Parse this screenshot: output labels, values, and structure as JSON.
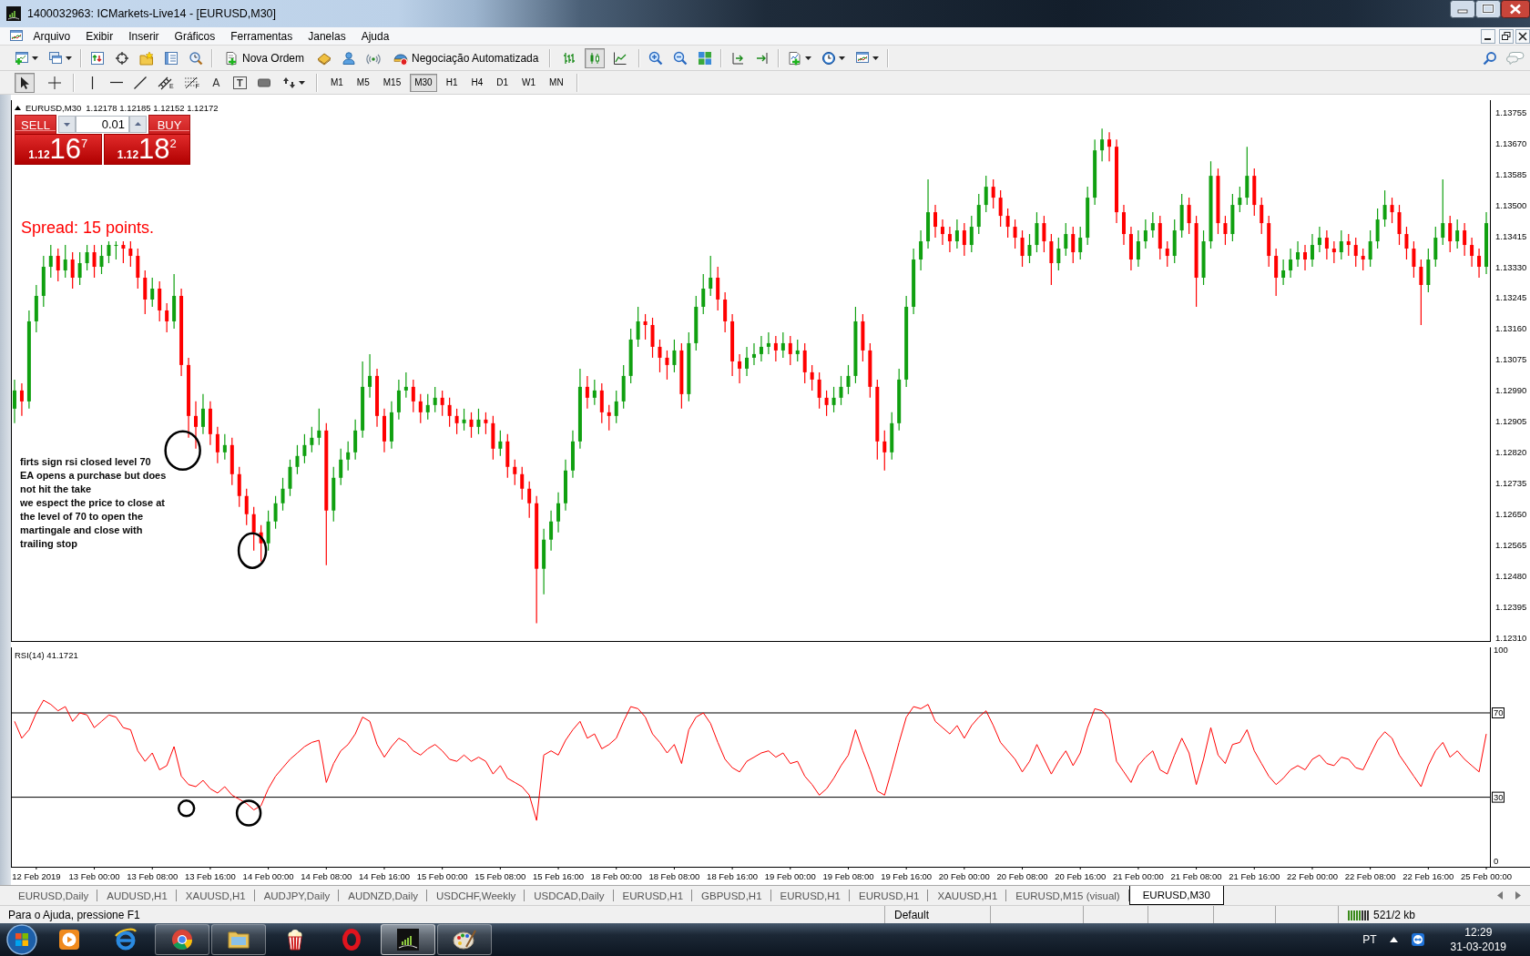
{
  "window": {
    "title": "1400032963: ICMarkets-Live14 - [EURUSD,M30]"
  },
  "menu": [
    "Arquivo",
    "Exibir",
    "Inserir",
    "Gráficos",
    "Ferramentas",
    "Janelas",
    "Ajuda"
  ],
  "toolbar": {
    "buttons": [
      {
        "kind": "new-order",
        "label": "Nova Ordem"
      },
      {
        "kind": "auto-trading",
        "label": "Negociação Automatizada"
      }
    ],
    "chart_styles": [
      {
        "kind": "bars",
        "selected": false
      },
      {
        "kind": "candles",
        "selected": true
      },
      {
        "kind": "line",
        "selected": false
      }
    ]
  },
  "drawing_tools": [
    {
      "kind": "cursor",
      "selected": true
    },
    {
      "kind": "crosshair",
      "selected": false
    },
    {
      "kind": "vline",
      "selected": false
    },
    {
      "kind": "hline",
      "selected": false
    },
    {
      "kind": "trendline",
      "selected": false
    },
    {
      "kind": "channel",
      "label": "E",
      "selected": false
    },
    {
      "kind": "fibo",
      "label": "F",
      "selected": false
    },
    {
      "kind": "text",
      "label": "A",
      "selected": false
    },
    {
      "kind": "label",
      "label": "T",
      "selected": false
    },
    {
      "kind": "rectangle",
      "selected": false
    },
    {
      "kind": "arrows",
      "selected": false
    }
  ],
  "periods": [
    {
      "label": "M1",
      "selected": false
    },
    {
      "label": "M5",
      "selected": false
    },
    {
      "label": "M15",
      "selected": false
    },
    {
      "label": "M30",
      "selected": true
    },
    {
      "label": "H1",
      "selected": false
    },
    {
      "label": "H4",
      "selected": false
    },
    {
      "label": "D1",
      "selected": false
    },
    {
      "label": "W1",
      "selected": false
    },
    {
      "label": "MN",
      "selected": false
    }
  ],
  "chart": {
    "one_click": {
      "sell": "SELL",
      "buy": "BUY",
      "lot": "0.01",
      "sell_price": {
        "prefix": "1.12",
        "pips": "16",
        "fraction": "7"
      },
      "buy_price": {
        "prefix": "1.12",
        "pips": "18",
        "fraction": "2"
      }
    },
    "spread_note": "Spread: 15 points.",
    "comment_lines": [
      "firts sign rsi closed level 70",
      "EA opens a purchase but does",
      "not hit the take",
      "we espect the price to close at",
      "the level of 70 to open the",
      "martingale and close with",
      "trailing stop"
    ],
    "chart_data": [
      {
        "type": "candlestick",
        "title": "EURUSD,M30",
        "subtitle": "1.12178 1.12185 1.12152 1.12172",
        "ylim": [
          1.12299,
          1.13788
        ],
        "tick_labels": "y",
        "yticks": [
          {
            "value": 1.13755,
            "label": "1.13755"
          },
          {
            "value": 1.1367,
            "label": "1.13670"
          },
          {
            "value": 1.13585,
            "label": "1.13585"
          },
          {
            "value": 1.135,
            "label": "1.13500"
          },
          {
            "value": 1.13415,
            "label": "1.13415"
          },
          {
            "value": 1.1333,
            "label": "1.13330"
          },
          {
            "value": 1.13245,
            "label": "1.13245"
          },
          {
            "value": 1.1316,
            "label": "1.13160"
          },
          {
            "value": 1.13075,
            "label": "1.13075"
          },
          {
            "value": 1.1299,
            "label": "1.12990"
          },
          {
            "value": 1.12905,
            "label": "1.12905"
          },
          {
            "value": 1.1282,
            "label": "1.12820"
          },
          {
            "value": 1.12735,
            "label": "1.12735"
          },
          {
            "value": 1.1265,
            "label": "1.12650"
          },
          {
            "value": 1.12565,
            "label": "1.12565"
          },
          {
            "value": 1.1248,
            "label": "1.12480"
          },
          {
            "value": 1.12395,
            "label": "1.12395"
          },
          {
            "value": 1.1231,
            "label": "1.12310"
          }
        ],
        "categories": [
          null,
          null,
          null,
          null,
          null,
          null,
          null,
          null,
          null,
          null,
          null,
          null,
          null,
          null,
          null,
          null,
          null,
          null,
          null,
          null,
          null,
          null,
          null,
          null,
          null,
          null,
          null,
          null,
          null,
          null,
          null,
          null,
          null,
          null,
          null,
          null,
          null,
          null,
          null,
          null,
          null,
          null,
          null,
          null,
          null,
          null,
          null,
          null,
          null,
          null,
          null,
          null,
          null,
          null,
          null,
          null,
          null,
          null,
          null,
          null,
          null,
          null,
          null,
          null,
          null,
          null,
          null,
          null,
          null,
          null,
          null,
          null,
          null,
          null,
          null,
          null,
          null,
          null,
          null,
          null,
          null,
          null,
          null,
          null,
          null,
          null,
          null,
          null,
          null,
          null,
          null,
          null,
          null,
          null,
          null,
          null,
          null,
          null,
          null,
          null,
          null,
          null,
          null,
          null,
          null,
          null,
          null,
          null,
          null,
          null,
          null,
          null,
          null,
          null,
          null,
          null,
          null,
          null,
          null,
          null,
          null,
          null,
          null,
          null,
          null,
          null,
          null,
          null,
          null,
          null,
          null,
          null,
          null,
          null,
          null,
          null,
          null,
          null,
          null,
          null,
          null,
          null,
          null,
          null,
          null,
          null,
          null,
          null,
          null,
          null,
          null,
          null,
          null,
          null,
          null,
          null,
          null,
          null,
          null,
          null,
          null,
          null,
          null,
          null,
          null,
          null,
          null,
          null,
          null,
          null,
          null,
          null,
          null,
          null,
          null,
          null,
          null,
          null,
          null,
          null,
          null,
          null,
          null,
          null,
          null,
          null,
          null,
          null,
          null,
          null,
          null,
          null,
          null,
          null,
          null,
          null,
          null,
          null,
          null,
          null,
          null,
          null,
          null,
          null
        ],
        "ohlc": [
          [
            1.1294,
            1.1302,
            1.129,
            1.1299
          ],
          [
            1.1299,
            1.1301,
            1.1292,
            1.1296
          ],
          [
            1.1296,
            1.1321,
            1.1294,
            1.1318
          ],
          [
            1.1318,
            1.1328,
            1.1315,
            1.1325
          ],
          [
            1.1325,
            1.1336,
            1.1322,
            1.1333
          ],
          [
            1.1333,
            1.1339,
            1.133,
            1.1336
          ],
          [
            1.1336,
            1.1338,
            1.1329,
            1.1332
          ],
          [
            1.1332,
            1.1339,
            1.133,
            1.1335
          ],
          [
            1.1335,
            1.1337,
            1.1327,
            1.133
          ],
          [
            1.133,
            1.1337,
            1.1328,
            1.1334
          ],
          [
            1.1334,
            1.1339,
            1.1332,
            1.1337
          ],
          [
            1.1337,
            1.1339,
            1.133,
            1.1333
          ],
          [
            1.1333,
            1.1339,
            1.1331,
            1.1336
          ],
          [
            1.1336,
            1.134,
            1.1334,
            1.1339
          ],
          [
            1.1339,
            1.134,
            1.1335,
            1.1339
          ],
          [
            1.1339,
            1.134,
            1.1334,
            1.1338
          ],
          [
            1.1338,
            1.134,
            1.1333,
            1.1336
          ],
          [
            1.1336,
            1.1338,
            1.1327,
            1.133
          ],
          [
            1.133,
            1.1332,
            1.132,
            1.1324
          ],
          [
            1.1324,
            1.133,
            1.1322,
            1.1327
          ],
          [
            1.1327,
            1.1329,
            1.1318,
            1.1321
          ],
          [
            1.1321,
            1.1323,
            1.1315,
            1.1318
          ],
          [
            1.1318,
            1.1331,
            1.1316,
            1.1325
          ],
          [
            1.1325,
            1.1327,
            1.1303,
            1.1306
          ],
          [
            1.1306,
            1.1308,
            1.1286,
            1.1292
          ],
          [
            1.1292,
            1.1296,
            1.1283,
            1.1289
          ],
          [
            1.1289,
            1.1298,
            1.1287,
            1.1294
          ],
          [
            1.1294,
            1.1296,
            1.1284,
            1.1287
          ],
          [
            1.1287,
            1.1289,
            1.1279,
            1.1282
          ],
          [
            1.1282,
            1.1287,
            1.128,
            1.1284
          ],
          [
            1.1284,
            1.1286,
            1.1273,
            1.1276
          ],
          [
            1.1276,
            1.1278,
            1.1267,
            1.127
          ],
          [
            1.127,
            1.1272,
            1.1262,
            1.1265
          ],
          [
            1.1265,
            1.1267,
            1.1255,
            1.126
          ],
          [
            1.126,
            1.1262,
            1.1252,
            1.1257
          ],
          [
            1.1257,
            1.1266,
            1.1255,
            1.1263
          ],
          [
            1.1263,
            1.127,
            1.1261,
            1.1268
          ],
          [
            1.1268,
            1.1275,
            1.1266,
            1.1272
          ],
          [
            1.1272,
            1.128,
            1.127,
            1.1278
          ],
          [
            1.1278,
            1.1284,
            1.1276,
            1.1281
          ],
          [
            1.1281,
            1.1287,
            1.1279,
            1.1284
          ],
          [
            1.1284,
            1.1289,
            1.1282,
            1.1286
          ],
          [
            1.1286,
            1.1294,
            1.1284,
            1.1288
          ],
          [
            1.1288,
            1.129,
            1.1251,
            1.1266
          ],
          [
            1.1266,
            1.1278,
            1.1263,
            1.1275
          ],
          [
            1.1275,
            1.1283,
            1.1273,
            1.128
          ],
          [
            1.128,
            1.1285,
            1.1277,
            1.1282
          ],
          [
            1.1282,
            1.1291,
            1.128,
            1.1288
          ],
          [
            1.1288,
            1.1307,
            1.1286,
            1.13
          ],
          [
            1.13,
            1.1309,
            1.1297,
            1.1303
          ],
          [
            1.1303,
            1.1305,
            1.1289,
            1.1292
          ],
          [
            1.1292,
            1.1294,
            1.1282,
            1.1285
          ],
          [
            1.1285,
            1.1296,
            1.1283,
            1.1293
          ],
          [
            1.1293,
            1.1302,
            1.1291,
            1.1299
          ],
          [
            1.1299,
            1.1304,
            1.1297,
            1.13
          ],
          [
            1.13,
            1.1302,
            1.1293,
            1.1296
          ],
          [
            1.1296,
            1.1298,
            1.129,
            1.1293
          ],
          [
            1.1293,
            1.1298,
            1.1291,
            1.1295
          ],
          [
            1.1295,
            1.13,
            1.1293,
            1.1297
          ],
          [
            1.1297,
            1.1299,
            1.1292,
            1.1295
          ],
          [
            1.1295,
            1.1297,
            1.1289,
            1.1292
          ],
          [
            1.1292,
            1.1294,
            1.1287,
            1.129
          ],
          [
            1.129,
            1.1294,
            1.1288,
            1.1291
          ],
          [
            1.1291,
            1.1293,
            1.1286,
            1.1289
          ],
          [
            1.1289,
            1.1294,
            1.1287,
            1.1291
          ],
          [
            1.1291,
            1.1293,
            1.1287,
            1.129
          ],
          [
            1.129,
            1.1292,
            1.128,
            1.1283
          ],
          [
            1.1283,
            1.1288,
            1.1281,
            1.1285
          ],
          [
            1.1285,
            1.1287,
            1.1275,
            1.1278
          ],
          [
            1.1278,
            1.128,
            1.1273,
            1.1276
          ],
          [
            1.1276,
            1.1278,
            1.1269,
            1.1272
          ],
          [
            1.1272,
            1.1274,
            1.1264,
            1.1268
          ],
          [
            1.1268,
            1.127,
            1.1235,
            1.125
          ],
          [
            1.125,
            1.1261,
            1.1243,
            1.1258
          ],
          [
            1.1258,
            1.1266,
            1.1255,
            1.1263
          ],
          [
            1.1263,
            1.1271,
            1.126,
            1.1268
          ],
          [
            1.1268,
            1.128,
            1.1266,
            1.1277
          ],
          [
            1.1277,
            1.1288,
            1.1275,
            1.1285
          ],
          [
            1.1285,
            1.1305,
            1.1283,
            1.13
          ],
          [
            1.13,
            1.1303,
            1.1294,
            1.1297
          ],
          [
            1.1297,
            1.1302,
            1.1295,
            1.1299
          ],
          [
            1.1299,
            1.1301,
            1.129,
            1.1293
          ],
          [
            1.1293,
            1.1295,
            1.1288,
            1.1292
          ],
          [
            1.1292,
            1.1299,
            1.129,
            1.1296
          ],
          [
            1.1296,
            1.1306,
            1.1294,
            1.1303
          ],
          [
            1.1303,
            1.1316,
            1.1301,
            1.1313
          ],
          [
            1.1313,
            1.1322,
            1.1311,
            1.1318
          ],
          [
            1.1318,
            1.132,
            1.1313,
            1.1317
          ],
          [
            1.1317,
            1.1319,
            1.1308,
            1.1311
          ],
          [
            1.1311,
            1.1313,
            1.1304,
            1.1308
          ],
          [
            1.1308,
            1.131,
            1.1302,
            1.1306
          ],
          [
            1.1306,
            1.1313,
            1.1304,
            1.131
          ],
          [
            1.131,
            1.1312,
            1.1294,
            1.1298
          ],
          [
            1.1298,
            1.1315,
            1.1296,
            1.1312
          ],
          [
            1.1312,
            1.1325,
            1.131,
            1.1322
          ],
          [
            1.1322,
            1.1331,
            1.132,
            1.1327
          ],
          [
            1.1327,
            1.1336,
            1.1325,
            1.133
          ],
          [
            1.133,
            1.1333,
            1.1321,
            1.1324
          ],
          [
            1.1324,
            1.1326,
            1.1315,
            1.1318
          ],
          [
            1.1318,
            1.132,
            1.1303,
            1.1307
          ],
          [
            1.1307,
            1.1309,
            1.1301,
            1.1305
          ],
          [
            1.1305,
            1.1311,
            1.1303,
            1.1308
          ],
          [
            1.1308,
            1.1312,
            1.1306,
            1.1309
          ],
          [
            1.1309,
            1.1314,
            1.1307,
            1.1311
          ],
          [
            1.1311,
            1.1315,
            1.1309,
            1.1312
          ],
          [
            1.1312,
            1.1314,
            1.1307,
            1.131
          ],
          [
            1.131,
            1.1315,
            1.1308,
            1.1312
          ],
          [
            1.1312,
            1.1314,
            1.1306,
            1.1309
          ],
          [
            1.1309,
            1.1313,
            1.1307,
            1.131
          ],
          [
            1.131,
            1.1312,
            1.1301,
            1.1304
          ],
          [
            1.1304,
            1.1306,
            1.1299,
            1.1302
          ],
          [
            1.1302,
            1.1304,
            1.1294,
            1.1297
          ],
          [
            1.1297,
            1.1299,
            1.1292,
            1.1295
          ],
          [
            1.1295,
            1.13,
            1.1293,
            1.1297
          ],
          [
            1.1297,
            1.1303,
            1.1295,
            1.13
          ],
          [
            1.13,
            1.1306,
            1.1298,
            1.1303
          ],
          [
            1.1303,
            1.1322,
            1.1301,
            1.1318
          ],
          [
            1.1318,
            1.132,
            1.1307,
            1.131
          ],
          [
            1.131,
            1.1312,
            1.1297,
            1.13
          ],
          [
            1.13,
            1.1302,
            1.128,
            1.1285
          ],
          [
            1.1285,
            1.1288,
            1.1277,
            1.1282
          ],
          [
            1.1282,
            1.1293,
            1.128,
            1.129
          ],
          [
            1.129,
            1.1305,
            1.1288,
            1.1302
          ],
          [
            1.1302,
            1.1325,
            1.13,
            1.1322
          ],
          [
            1.1322,
            1.1338,
            1.132,
            1.1335
          ],
          [
            1.1335,
            1.1343,
            1.1332,
            1.134
          ],
          [
            1.134,
            1.1357,
            1.1338,
            1.1348
          ],
          [
            1.1348,
            1.135,
            1.1341,
            1.1344
          ],
          [
            1.1344,
            1.1346,
            1.1339,
            1.1342
          ],
          [
            1.1342,
            1.1344,
            1.1337,
            1.134
          ],
          [
            1.134,
            1.1346,
            1.1338,
            1.1343
          ],
          [
            1.1343,
            1.1345,
            1.1336,
            1.1339
          ],
          [
            1.1339,
            1.1347,
            1.1337,
            1.1344
          ],
          [
            1.1344,
            1.1353,
            1.1342,
            1.135
          ],
          [
            1.135,
            1.1358,
            1.1348,
            1.1355
          ],
          [
            1.1355,
            1.1357,
            1.1349,
            1.1352
          ],
          [
            1.1352,
            1.1354,
            1.1344,
            1.1347
          ],
          [
            1.1347,
            1.1349,
            1.1341,
            1.1344
          ],
          [
            1.1344,
            1.1346,
            1.1338,
            1.1341
          ],
          [
            1.1341,
            1.1343,
            1.1333,
            1.1336
          ],
          [
            1.1336,
            1.1342,
            1.1334,
            1.1339
          ],
          [
            1.1339,
            1.1348,
            1.1337,
            1.1345
          ],
          [
            1.1345,
            1.1347,
            1.1337,
            1.134
          ],
          [
            1.134,
            1.1342,
            1.1328,
            1.1334
          ],
          [
            1.1334,
            1.1341,
            1.1332,
            1.1338
          ],
          [
            1.1338,
            1.1345,
            1.1336,
            1.1342
          ],
          [
            1.1342,
            1.1344,
            1.1334,
            1.1337
          ],
          [
            1.1337,
            1.1344,
            1.1335,
            1.1341
          ],
          [
            1.1341,
            1.1355,
            1.1339,
            1.1352
          ],
          [
            1.1352,
            1.1368,
            1.135,
            1.1365
          ],
          [
            1.1365,
            1.1371,
            1.1362,
            1.1368
          ],
          [
            1.1368,
            1.137,
            1.1362,
            1.1366
          ],
          [
            1.1366,
            1.1368,
            1.1345,
            1.1348
          ],
          [
            1.1348,
            1.135,
            1.1339,
            1.1342
          ],
          [
            1.1342,
            1.1344,
            1.1332,
            1.1335
          ],
          [
            1.1335,
            1.1343,
            1.1333,
            1.134
          ],
          [
            1.134,
            1.1346,
            1.1338,
            1.1343
          ],
          [
            1.1343,
            1.1348,
            1.1341,
            1.1345
          ],
          [
            1.1345,
            1.1347,
            1.1335,
            1.1338
          ],
          [
            1.1338,
            1.134,
            1.1333,
            1.1336
          ],
          [
            1.1336,
            1.1346,
            1.1334,
            1.1343
          ],
          [
            1.1343,
            1.1353,
            1.1341,
            1.135
          ],
          [
            1.135,
            1.1352,
            1.1342,
            1.1345
          ],
          [
            1.1345,
            1.1347,
            1.1322,
            1.133
          ],
          [
            1.133,
            1.1343,
            1.1328,
            1.134
          ],
          [
            1.134,
            1.1362,
            1.1338,
            1.1358
          ],
          [
            1.1358,
            1.136,
            1.1342,
            1.1345
          ],
          [
            1.1345,
            1.1347,
            1.1339,
            1.1342
          ],
          [
            1.1342,
            1.1353,
            1.134,
            1.135
          ],
          [
            1.135,
            1.1355,
            1.1348,
            1.1352
          ],
          [
            1.1352,
            1.1366,
            1.135,
            1.1358
          ],
          [
            1.1358,
            1.136,
            1.1347,
            1.135
          ],
          [
            1.135,
            1.1352,
            1.1342,
            1.1345
          ],
          [
            1.1345,
            1.1347,
            1.1333,
            1.1336
          ],
          [
            1.1336,
            1.1338,
            1.1325,
            1.133
          ],
          [
            1.133,
            1.1335,
            1.1328,
            1.1332
          ],
          [
            1.1332,
            1.1338,
            1.133,
            1.1335
          ],
          [
            1.1335,
            1.134,
            1.1333,
            1.1337
          ],
          [
            1.1337,
            1.1339,
            1.1332,
            1.1335
          ],
          [
            1.1335,
            1.1342,
            1.1333,
            1.1339
          ],
          [
            1.1339,
            1.1344,
            1.1337,
            1.1341
          ],
          [
            1.1341,
            1.1343,
            1.1335,
            1.1338
          ],
          [
            1.1338,
            1.134,
            1.1334,
            1.1337
          ],
          [
            1.1337,
            1.1343,
            1.1335,
            1.134
          ],
          [
            1.134,
            1.1342,
            1.1336,
            1.1339
          ],
          [
            1.1339,
            1.1341,
            1.1333,
            1.1336
          ],
          [
            1.1336,
            1.1338,
            1.1332,
            1.1335
          ],
          [
            1.1335,
            1.1343,
            1.1333,
            1.134
          ],
          [
            1.134,
            1.1349,
            1.1338,
            1.1346
          ],
          [
            1.1346,
            1.1354,
            1.1344,
            1.135
          ],
          [
            1.135,
            1.1352,
            1.1345,
            1.1348
          ],
          [
            1.1348,
            1.135,
            1.1339,
            1.1342
          ],
          [
            1.1342,
            1.1344,
            1.1335,
            1.1338
          ],
          [
            1.1338,
            1.134,
            1.133,
            1.1333
          ],
          [
            1.1333,
            1.1335,
            1.1317,
            1.1328
          ],
          [
            1.1328,
            1.1338,
            1.1326,
            1.1335
          ],
          [
            1.1335,
            1.1344,
            1.1333,
            1.1341
          ],
          [
            1.1341,
            1.1357,
            1.1339,
            1.1345
          ],
          [
            1.1345,
            1.1347,
            1.1337,
            1.134
          ],
          [
            1.134,
            1.1346,
            1.1338,
            1.1343
          ],
          [
            1.1343,
            1.1345,
            1.1336,
            1.1339
          ],
          [
            1.1339,
            1.1341,
            1.1333,
            1.1336
          ],
          [
            1.1336,
            1.1338,
            1.133,
            1.1333
          ],
          [
            1.1333,
            1.1348,
            1.1331,
            1.1345
          ]
        ]
      },
      {
        "type": "line",
        "title": "RSI(14) 41.1721",
        "color": "#ff0000",
        "ylim": [
          -3,
          101.1
        ],
        "yticks": [
          100,
          0
        ],
        "ref_lines": [
          {
            "axis": "y",
            "value": 70,
            "label": "70",
            "color": "#000000"
          },
          {
            "axis": "y",
            "value": 30,
            "label": "30",
            "color": "#000000"
          }
        ],
        "categories": [
          null,
          null,
          null,
          "12 Feb 2019",
          null,
          null,
          null,
          null,
          null,
          null,
          null,
          "13 Feb 00:00",
          null,
          null,
          null,
          null,
          null,
          null,
          null,
          "13 Feb 08:00",
          null,
          null,
          null,
          null,
          null,
          null,
          null,
          "13 Feb 16:00",
          null,
          null,
          null,
          null,
          null,
          null,
          null,
          "14 Feb 00:00",
          null,
          null,
          null,
          null,
          null,
          null,
          null,
          "14 Feb 08:00",
          null,
          null,
          null,
          null,
          null,
          null,
          null,
          "14 Feb 16:00",
          null,
          null,
          null,
          null,
          null,
          null,
          null,
          "15 Feb 00:00",
          null,
          null,
          null,
          null,
          null,
          null,
          null,
          "15 Feb 08:00",
          null,
          null,
          null,
          null,
          null,
          null,
          null,
          "15 Feb 16:00",
          null,
          null,
          null,
          null,
          null,
          null,
          null,
          "18 Feb 00:00",
          null,
          null,
          null,
          null,
          null,
          null,
          null,
          "18 Feb 08:00",
          null,
          null,
          null,
          null,
          null,
          null,
          null,
          "18 Feb 16:00",
          null,
          null,
          null,
          null,
          null,
          null,
          null,
          "19 Feb 00:00",
          null,
          null,
          null,
          null,
          null,
          null,
          null,
          "19 Feb 08:00",
          null,
          null,
          null,
          null,
          null,
          null,
          null,
          "19 Feb 16:00",
          null,
          null,
          null,
          null,
          null,
          null,
          null,
          "20 Feb 00:00",
          null,
          null,
          null,
          null,
          null,
          null,
          null,
          "20 Feb 08:00",
          null,
          null,
          null,
          null,
          null,
          null,
          null,
          "20 Feb 16:00",
          null,
          null,
          null,
          null,
          null,
          null,
          null,
          "21 Feb 00:00",
          null,
          null,
          null,
          null,
          null,
          null,
          null,
          "21 Feb 08:00",
          null,
          null,
          null,
          null,
          null,
          null,
          null,
          "21 Feb 16:00",
          null,
          null,
          null,
          null,
          null,
          null,
          null,
          "22 Feb 00:00",
          null,
          null,
          null,
          null,
          null,
          null,
          null,
          "22 Feb 08:00",
          null,
          null,
          null,
          null,
          null,
          null,
          null,
          "22 Feb 16:00",
          null,
          null,
          null,
          null,
          null,
          null,
          null,
          "25 Feb 00:00"
        ],
        "values": [
          66,
          58,
          62,
          70,
          76,
          74,
          71,
          73,
          66,
          70,
          69,
          63,
          66,
          69,
          68,
          63,
          62,
          52,
          47,
          51,
          43,
          45,
          54,
          40,
          36,
          35,
          38,
          34,
          32,
          35,
          31,
          29,
          27,
          24,
          26,
          34,
          40,
          44,
          48,
          51,
          54,
          56,
          57,
          37,
          46,
          52,
          55,
          60,
          68,
          66,
          55,
          49,
          54,
          58,
          56,
          52,
          50,
          53,
          55,
          52,
          48,
          47,
          50,
          47,
          49,
          47,
          41,
          45,
          39,
          37,
          35,
          31,
          19,
          50,
          52,
          50,
          57,
          62,
          66,
          58,
          60,
          53,
          55,
          58,
          66,
          73,
          72,
          68,
          60,
          56,
          51,
          55,
          46,
          62,
          68,
          70,
          65,
          56,
          48,
          44,
          42,
          47,
          49,
          51,
          52,
          49,
          51,
          46,
          47,
          40,
          36,
          31,
          34,
          39,
          45,
          50,
          62,
          52,
          43,
          33,
          31,
          43,
          56,
          68,
          73,
          72,
          74,
          66,
          63,
          60,
          64,
          58,
          64,
          68,
          71,
          64,
          56,
          52,
          48,
          42,
          47,
          55,
          48,
          41,
          47,
          52,
          45,
          51,
          63,
          72,
          71,
          67,
          47,
          42,
          37,
          45,
          49,
          52,
          43,
          41,
          50,
          58,
          51,
          36,
          48,
          63,
          50,
          46,
          55,
          56,
          62,
          52,
          46,
          40,
          36,
          39,
          43,
          45,
          43,
          48,
          50,
          46,
          45,
          49,
          48,
          44,
          43,
          50,
          57,
          61,
          58,
          50,
          45,
          40,
          35,
          45,
          52,
          56,
          49,
          52,
          48,
          45,
          42,
          60
        ]
      }
    ]
  },
  "tabs": [
    {
      "label": "EURUSD,Daily",
      "selected": false
    },
    {
      "label": "AUDUSD,H1",
      "selected": false
    },
    {
      "label": "XAUUSD,H1",
      "selected": false
    },
    {
      "label": "AUDJPY,Daily",
      "selected": false
    },
    {
      "label": "AUDNZD,Daily",
      "selected": false
    },
    {
      "label": "USDCHF,Weekly",
      "selected": false
    },
    {
      "label": "USDCAD,Daily",
      "selected": false
    },
    {
      "label": "EURUSD,H1",
      "selected": false
    },
    {
      "label": "GBPUSD,H1",
      "selected": false
    },
    {
      "label": "EURUSD,H1",
      "selected": false
    },
    {
      "label": "EURUSD,H1",
      "selected": false
    },
    {
      "label": "XAUUSD,H1",
      "selected": false
    },
    {
      "label": "EURUSD,M15 (visual)",
      "selected": false
    },
    {
      "label": "EURUSD,M30",
      "selected": true
    }
  ],
  "status_bar": {
    "help": "Para o Ajuda, pressione F1",
    "profile": "Default",
    "traffic": "521/2 kb"
  },
  "taskbar": {
    "apps": [
      {
        "kind": "play",
        "running": false,
        "selected": false
      },
      {
        "kind": "ring-swoosh",
        "running": false,
        "selected": false
      },
      {
        "kind": "tricolor",
        "running": true,
        "selected": false
      },
      {
        "kind": "folder",
        "running": true,
        "selected": false
      },
      {
        "kind": "popcorn",
        "running": false,
        "selected": false
      },
      {
        "kind": "ring",
        "running": false,
        "selected": false
      },
      {
        "kind": "bars",
        "running": true,
        "selected": true
      },
      {
        "kind": "palette",
        "running": true,
        "selected": false
      }
    ],
    "language": "PT",
    "time": "12:29",
    "date": "31-03-2019"
  }
}
